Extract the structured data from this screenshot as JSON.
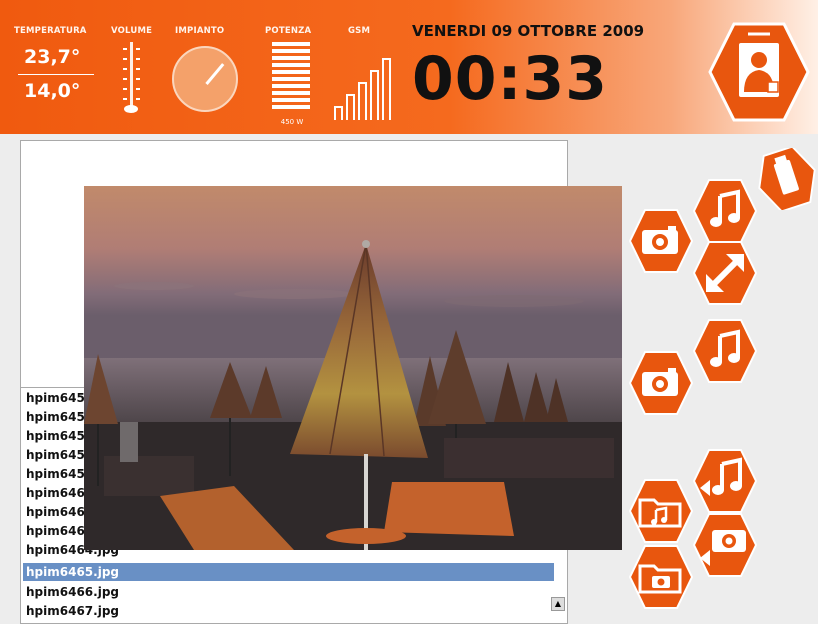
{
  "header": {
    "labels": {
      "temperature": "TEMPERATURA",
      "volume": "VOLUME",
      "system": "IMPIANTO",
      "power": "POTENZA",
      "gsm": "GSM"
    },
    "temperature_current": "23,7°",
    "temperature_setpoint": "14,0°",
    "power_value": "450 W",
    "date": "VENERDI 09 OTTOBRE 2009",
    "time": "00:33",
    "accent_color": "#f05a0f"
  },
  "file_list": {
    "items": [
      "hpim645",
      "hpim645",
      "hpim645",
      "hpim645",
      "hpim645",
      "hpim646",
      "hpim646",
      "hpim646",
      "hpim6464.jpg",
      "hpim6465.jpg",
      "hpim6466.jpg",
      "hpim6467.jpg"
    ],
    "selected": "hpim6465.jpg"
  },
  "side_buttons": [
    {
      "icon": "usb-drive-icon"
    },
    {
      "icon": "music-note-icon"
    },
    {
      "icon": "camera-icon"
    },
    {
      "icon": "expand-arrows-icon"
    },
    {
      "icon": "music-note-icon"
    },
    {
      "icon": "camera-icon"
    },
    {
      "icon": "music-note-back-icon"
    },
    {
      "icon": "music-folder-icon"
    },
    {
      "icon": "camera-back-icon"
    },
    {
      "icon": "photo-folder-icon"
    }
  ],
  "icons": {
    "user": "user-profile-icon",
    "volume": "volume-slider-icon",
    "dial": "system-dial-icon",
    "power": "power-meter-icon",
    "signal": "gsm-signal-icon"
  }
}
